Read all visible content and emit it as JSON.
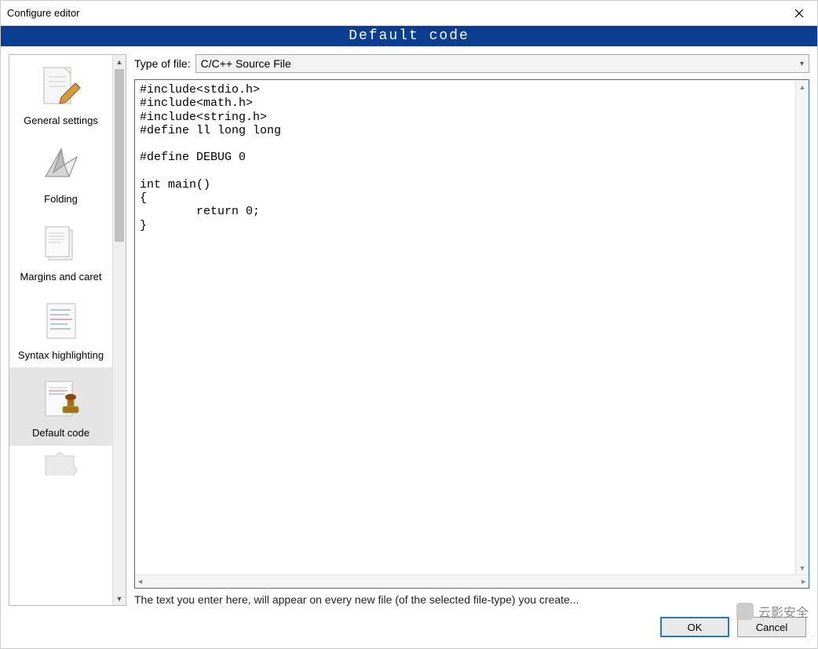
{
  "window": {
    "title": "Configure editor",
    "banner": "Default code"
  },
  "sidebar": {
    "items": [
      {
        "label": "General settings",
        "icon": "page-pencil-icon",
        "selected": false
      },
      {
        "label": "Folding",
        "icon": "origami-icon",
        "selected": false
      },
      {
        "label": "Margins and caret",
        "icon": "pages-stack-icon",
        "selected": false
      },
      {
        "label": "Syntax highlighting",
        "icon": "code-page-icon",
        "selected": false
      },
      {
        "label": "Default code",
        "icon": "stamp-page-icon",
        "selected": true
      }
    ]
  },
  "main": {
    "type_label": "Type of file:",
    "type_value": "C/C++ Source File",
    "code": "#include<stdio.h>\n#include<math.h>\n#include<string.h>\n#define ll long long\n\n#define DEBUG 0\n\nint main()\n{\n        return 0;\n}",
    "hint": "The text you enter here, will appear on every new file (of the selected file-type) you create..."
  },
  "buttons": {
    "ok": "OK",
    "cancel": "Cancel"
  },
  "watermark": "云影安全"
}
